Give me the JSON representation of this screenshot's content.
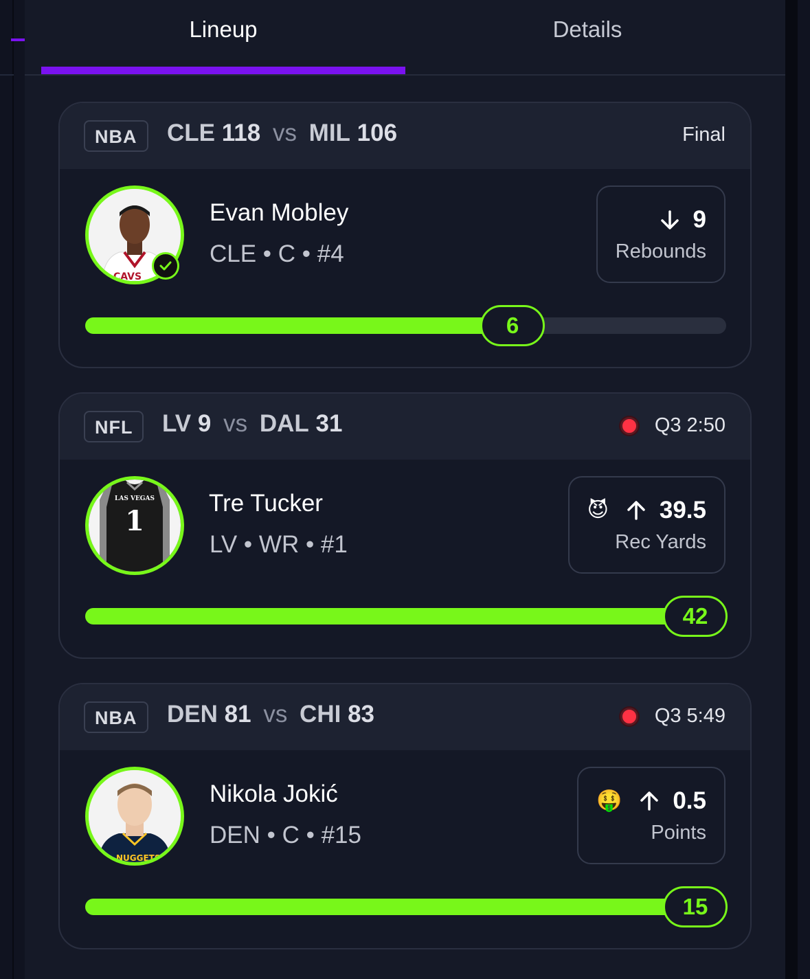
{
  "tabs": [
    {
      "label": "Lineup",
      "active": true
    },
    {
      "label": "Details",
      "active": false
    }
  ],
  "colors": {
    "accent": "#7a12f0",
    "progress": "#78f71a",
    "live": "#ff3244"
  },
  "cards": [
    {
      "league": "NBA",
      "team1": "CLE",
      "score1": "118",
      "vs": "vs",
      "team2": "MIL",
      "score2": "106",
      "status": "Final",
      "live": false,
      "player": {
        "name": "Evan Mobley",
        "info": "CLE • C • #4",
        "avatar_icon": "player-headshot-icon",
        "verified": true
      },
      "stat": {
        "emoji": "",
        "direction": "down",
        "line": "9",
        "label": "Rebounds"
      },
      "progress": {
        "value": "6",
        "fraction": 0.62
      }
    },
    {
      "league": "NFL",
      "team1": "LV",
      "score1": "9",
      "vs": "vs",
      "team2": "DAL",
      "score2": "31",
      "status": "Q3 2:50",
      "live": true,
      "player": {
        "name": "Tre Tucker",
        "info": "LV • WR • #1",
        "avatar_icon": "jersey-icon",
        "verified": false
      },
      "stat": {
        "emoji": "😈",
        "direction": "up",
        "line": "39.5",
        "label": "Rec Yards"
      },
      "progress": {
        "value": "42",
        "fraction": 1.0
      }
    },
    {
      "league": "NBA",
      "team1": "DEN",
      "score1": "81",
      "vs": "vs",
      "team2": "CHI",
      "score2": "83",
      "status": "Q3 5:49",
      "live": true,
      "player": {
        "name": "Nikola Jokić",
        "info": "DEN • C • #15",
        "avatar_icon": "player-headshot-icon",
        "verified": false
      },
      "stat": {
        "emoji": "🤑",
        "direction": "up",
        "line": "0.5",
        "label": "Points"
      },
      "progress": {
        "value": "15",
        "fraction": 1.0
      }
    }
  ]
}
